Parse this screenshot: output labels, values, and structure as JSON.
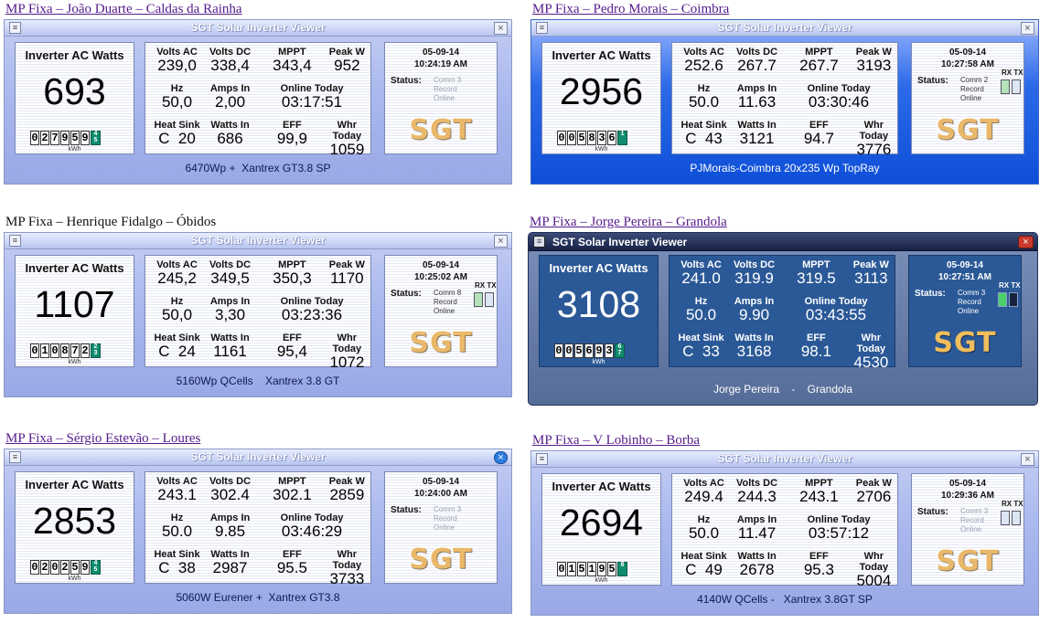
{
  "window": {
    "title": "SGT Solar Inverter Viewer",
    "icon": "window-menu-icon",
    "close_glyph": "×"
  },
  "labels": {
    "watts": "Inverter AC Watts",
    "volts_ac": "Volts AC",
    "volts_dc": "Volts DC",
    "mppt": "MPPT",
    "peak_w": "Peak W",
    "hz": "Hz",
    "amps_in": "Amps In",
    "online_today": "Online Today",
    "heat_sink": "Heat Sink",
    "watts_in": "Watts In",
    "eff": "EFF",
    "whr_today": "Whr Today",
    "kwh": "kWh",
    "status": "Status:",
    "comm": "Comm",
    "record": "Record",
    "online": "Online",
    "rx_tx": "RX TX",
    "logo": "SGT"
  },
  "colors": {
    "caption_link": "#551a8b",
    "odometer_fraction": "#108c6e",
    "logo_gold": "#e9b86a"
  },
  "cells": [
    {
      "caption": "MP Fixa – João Duarte – Caldas da Rainha",
      "link": true,
      "theme": "classic",
      "watts": "693",
      "odo": [
        "0",
        "2",
        "7",
        "9",
        "5",
        "9"
      ],
      "odo_frac": [
        "4",
        "5"
      ],
      "volts_ac": "239,0",
      "volts_dc": "338,4",
      "mppt": "343,4",
      "peak_w": "952",
      "hz": "50,0",
      "amps_in": "2,00",
      "online_today": "03:17:51",
      "heat_sink": "C  20",
      "watts_in": "686",
      "eff": "99,9",
      "whr_today": "1059",
      "date": "05-09-14",
      "time": "10:24:19 AM",
      "comm_n": "3",
      "show_rxtx": false,
      "footer": "6470Wp +  Xantrex GT3.8 SP"
    },
    {
      "caption": "MP Fixa – Pedro Morais – Coimbra",
      "link": true,
      "theme": "blue",
      "watts": "2956",
      "odo": [
        "0",
        "0",
        "5",
        "8",
        "3",
        "6"
      ],
      "odo_frac": [
        "",
        "1"
      ],
      "volts_ac": "252.6",
      "volts_dc": "267.7",
      "mppt": "267.7",
      "peak_w": "3193",
      "hz": "50.0",
      "amps_in": "11.63",
      "online_today": "03:30:46",
      "heat_sink": "C  43",
      "watts_in": "3121",
      "eff": "94.7",
      "whr_today": "3776",
      "date": "05-09-14",
      "time": "10:27:58 AM",
      "comm_n": "2",
      "show_rxtx": true,
      "led_rx": "green",
      "footer": "PJMorais-Coimbra 20x235 Wp TopRay"
    },
    {
      "caption": "MP Fixa – Henrique Fidalgo – Óbidos",
      "link": false,
      "theme": "classic",
      "watts": "1107",
      "odo": [
        "0",
        "1",
        "0",
        "8",
        "7",
        "2"
      ],
      "odo_frac": [
        "2",
        "3"
      ],
      "volts_ac": "245,2",
      "volts_dc": "349,5",
      "mppt": "350,3",
      "peak_w": "1170",
      "hz": "50,0",
      "amps_in": "3,30",
      "online_today": "03:23:36",
      "heat_sink": "C  24",
      "watts_in": "1161",
      "eff": "95,4",
      "whr_today": "1072",
      "date": "05-09-14",
      "time": "10:25:02 AM",
      "comm_n": "8",
      "show_rxtx": true,
      "led_rx": "green",
      "footer": "5160Wp QCells    Xantrex 3.8 GT"
    },
    {
      "caption": "MP Fixa – Jorge Pereira – Grandola",
      "link": true,
      "theme": "dark",
      "watts": "3108",
      "odo": [
        "0",
        "0",
        "5",
        "6",
        "9",
        "3"
      ],
      "odo_frac": [
        "6",
        "7"
      ],
      "volts_ac": "241.0",
      "volts_dc": "319.9",
      "mppt": "319.5",
      "peak_w": "3113",
      "hz": "50.0",
      "amps_in": "9.90",
      "online_today": "03:43:55",
      "heat_sink": "C  33",
      "watts_in": "3168",
      "eff": "98.1",
      "whr_today": "4530",
      "date": "05-09-14",
      "time": "10:27:51 AM",
      "comm_n": "3",
      "show_rxtx": true,
      "led_rx": "green",
      "footer": "Jorge Pereira    -    Grandola"
    },
    {
      "caption": "MP Fixa – Sérgio Estevão – Loures",
      "link": true,
      "theme": "classic",
      "bubble_close": true,
      "watts": "2853",
      "odo": [
        "0",
        "2",
        "0",
        "2",
        "5",
        "9"
      ],
      "odo_frac": [
        "4",
        "5"
      ],
      "volts_ac": "243.1",
      "volts_dc": "302.4",
      "mppt": "302.1",
      "peak_w": "2859",
      "hz": "50.0",
      "amps_in": "9.85",
      "online_today": "03:46:29",
      "heat_sink": "C  38",
      "watts_in": "2987",
      "eff": "95.5",
      "whr_today": "3733",
      "date": "05-09-14",
      "time": "10:24:00 AM",
      "comm_n": "3",
      "show_rxtx": false,
      "footer": "5060W Eurener +  Xantrex GT3.8"
    },
    {
      "caption": "MP Fixa – V Lobinho – Borba",
      "link": true,
      "theme": "classic",
      "watts": "2694",
      "odo": [
        "0",
        "1",
        "5",
        "1",
        "9",
        "5"
      ],
      "odo_frac": [
        "",
        "8"
      ],
      "volts_ac": "249.4",
      "volts_dc": "244.3",
      "mppt": "243.1",
      "peak_w": "2706",
      "hz": "50.0",
      "amps_in": "11.47",
      "online_today": "03:57:12",
      "heat_sink": "C  49",
      "watts_in": "2678",
      "eff": "95.3",
      "whr_today": "5004",
      "date": "05-09-14",
      "time": "10:29:36 AM",
      "comm_n": "3",
      "show_rxtx": true,
      "footer": "4140W QCells -   Xantrex 3.8GT SP"
    }
  ]
}
